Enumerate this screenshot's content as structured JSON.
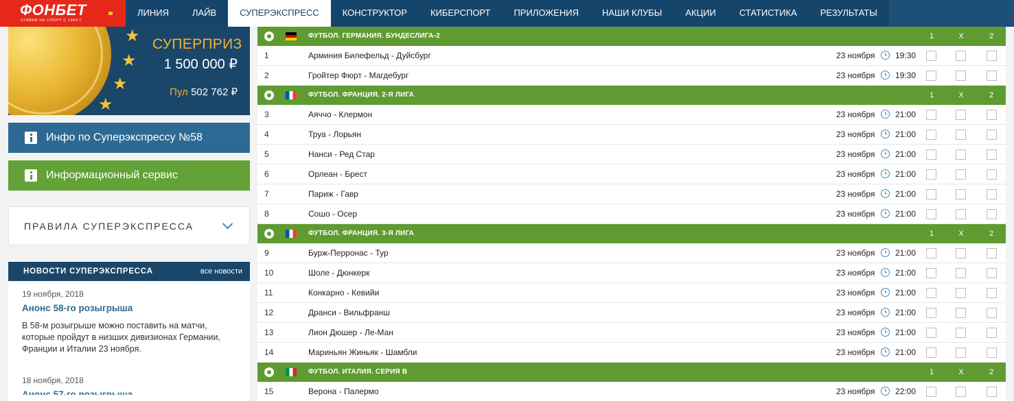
{
  "logo": {
    "text": "ФОНБЕТ",
    "tagline": "СТАВКИ НА СПОРТ С 1994 Г."
  },
  "nav": [
    {
      "label": "ЛИНИЯ",
      "active": false
    },
    {
      "label": "ЛАЙВ",
      "active": false
    },
    {
      "label": "СУПЕРЭКСПРЕСС",
      "active": true
    },
    {
      "label": "КОНСТРУКТОР",
      "active": false
    },
    {
      "label": "КИБЕРСПОРТ",
      "active": false
    },
    {
      "label": "ПРИЛОЖЕНИЯ",
      "active": false
    },
    {
      "label": "НАШИ КЛУБЫ",
      "active": false
    },
    {
      "label": "АКЦИИ",
      "active": false
    },
    {
      "label": "СТАТИСТИКА",
      "active": false
    },
    {
      "label": "РЕЗУЛЬТАТЫ",
      "active": false
    }
  ],
  "banner": {
    "title": "СУПЕРПРИЗ",
    "amount": "1 500 000 ₽",
    "pool_label": "Пул",
    "pool_value": "502 762 ₽"
  },
  "info_buttons": {
    "blue": "Инфо по Суперэкспрессу №58",
    "green": "Информационный сервис"
  },
  "rules": {
    "label": "ПРАВИЛА СУПЕРЭКСПРЕССА"
  },
  "news": {
    "title": "НОВОСТИ СУПЕРЭКСПРЕССА",
    "all_link": "все новости",
    "items": [
      {
        "date": "19 ноября, 2018",
        "title": "Анонс 58-го розыгрыша",
        "text": "В 58-м розыгрыше можно поставить на матчи, которые пройдут в низших дивизионах Германии, Франции и Италии 23 ноября."
      },
      {
        "date": "18 ноября, 2018",
        "title": "Анонс 57-го розыгрыша"
      }
    ]
  },
  "outcome_headers": [
    "1",
    "X",
    "2"
  ],
  "leagues": [
    {
      "name": "ФУТБОЛ. ГЕРМАНИЯ. БУНДЕСЛИГА-2",
      "flag": "de",
      "matches": [
        {
          "num": "1",
          "teams": "Арминия Билефельд - Дуйсбург",
          "date": "23 ноября",
          "time": "19:30"
        },
        {
          "num": "2",
          "teams": "Гройтер Фюрт - Магдебург",
          "date": "23 ноября",
          "time": "19:30"
        }
      ]
    },
    {
      "name": "ФУТБОЛ. ФРАНЦИЯ. 2-Я ЛИГА",
      "flag": "fr",
      "matches": [
        {
          "num": "3",
          "teams": "Аяччо - Клермон",
          "date": "23 ноября",
          "time": "21:00"
        },
        {
          "num": "4",
          "teams": "Труа - Лорьян",
          "date": "23 ноября",
          "time": "21:00"
        },
        {
          "num": "5",
          "teams": "Нанси - Ред Стар",
          "date": "23 ноября",
          "time": "21:00"
        },
        {
          "num": "6",
          "teams": "Орлеан - Брест",
          "date": "23 ноября",
          "time": "21:00"
        },
        {
          "num": "7",
          "teams": "Париж - Гавр",
          "date": "23 ноября",
          "time": "21:00"
        },
        {
          "num": "8",
          "teams": "Сошо - Осер",
          "date": "23 ноября",
          "time": "21:00"
        }
      ]
    },
    {
      "name": "ФУТБОЛ. ФРАНЦИЯ. 3-Я ЛИГА",
      "flag": "fr",
      "matches": [
        {
          "num": "9",
          "teams": "Бурж-Перронас - Тур",
          "date": "23 ноября",
          "time": "21:00"
        },
        {
          "num": "10",
          "teams": "Шоле - Дюнкерк",
          "date": "23 ноября",
          "time": "21:00"
        },
        {
          "num": "11",
          "teams": "Конкарно - Кевийи",
          "date": "23 ноября",
          "time": "21:00"
        },
        {
          "num": "12",
          "teams": "Дранси - Вильфранш",
          "date": "23 ноября",
          "time": "21:00"
        },
        {
          "num": "13",
          "teams": "Лион Дюшер - Ле-Ман",
          "date": "23 ноября",
          "time": "21:00"
        },
        {
          "num": "14",
          "teams": "Мариньян Жиньяк - Шамбли",
          "date": "23 ноября",
          "time": "21:00"
        }
      ]
    },
    {
      "name": "ФУТБОЛ. ИТАЛИЯ. СЕРИЯ B",
      "flag": "it",
      "matches": [
        {
          "num": "15",
          "teams": "Верона - Палермо",
          "date": "23 ноября",
          "time": "22:00"
        }
      ]
    }
  ]
}
